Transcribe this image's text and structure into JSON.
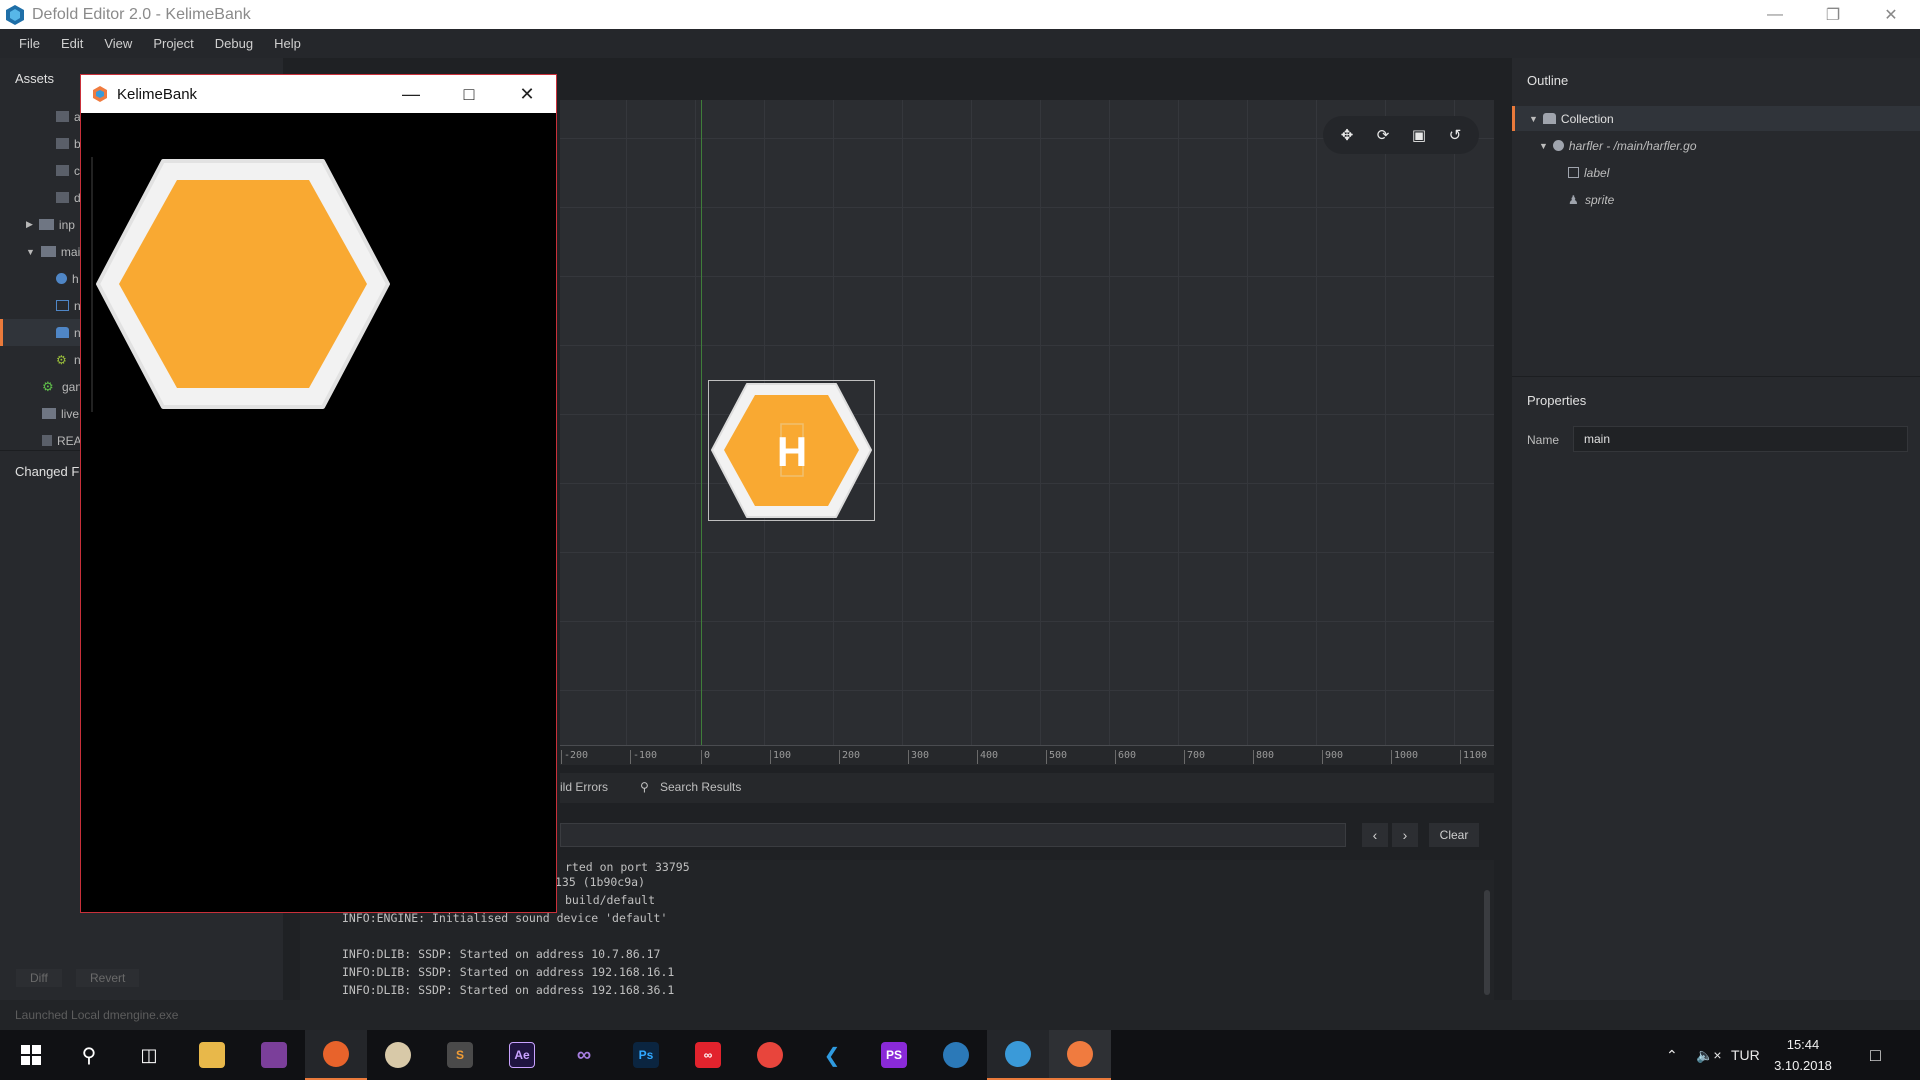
{
  "window": {
    "title": "Defold Editor 2.0 - KelimeBank"
  },
  "menu": [
    "File",
    "Edit",
    "View",
    "Project",
    "Debug",
    "Help"
  ],
  "assets": {
    "title": "Assets",
    "items": [
      {
        "label": "a",
        "icon": "file-icon"
      },
      {
        "label": "b",
        "icon": "file-icon"
      },
      {
        "label": "c",
        "icon": "file-icon"
      },
      {
        "label": "d",
        "icon": "file-icon"
      },
      {
        "label": "inp",
        "icon": "folder-icon"
      },
      {
        "label": "mai",
        "icon": "folder-icon"
      },
      {
        "label": "h",
        "icon": "gameobject-icon"
      },
      {
        "label": "n",
        "icon": "image-icon"
      },
      {
        "label": "n",
        "icon": "collection-icon"
      },
      {
        "label": "n",
        "icon": "gear-icon"
      },
      {
        "label": "gan",
        "icon": "gear-icon"
      },
      {
        "label": "live",
        "icon": "puzzle-icon"
      },
      {
        "label": "REA",
        "icon": "file-icon"
      }
    ]
  },
  "changed_files": {
    "title": "Changed Fil",
    "diff": "Diff",
    "revert": "Revert"
  },
  "status": {
    "text": "Launched Local dmengine.exe"
  },
  "viewport": {
    "ruler": [
      "-200",
      "-100",
      "0",
      "100",
      "200",
      "300",
      "400",
      "500",
      "600",
      "700",
      "800",
      "900",
      "1000",
      "1100"
    ],
    "sprite_letter": "H"
  },
  "console": {
    "tabs": {
      "build_errors": "ild Errors",
      "search_results": "Search Results"
    },
    "clear": "Clear",
    "lines": [
      "rted on port 33795",
      "135 (1b90c9a)",
      "build/default",
      "INFO:ENGINE: Initialised sound device 'default'",
      "",
      "INFO:DLIB: SSDP: Started on address 10.7.86.17",
      "INFO:DLIB: SSDP: Started on address 192.168.16.1",
      "INFO:DLIB: SSDP: Started on address 192.168.36.1"
    ]
  },
  "outline": {
    "title": "Outline",
    "items": [
      {
        "label": "Collection"
      },
      {
        "label": "harfler - /main/harfler.go"
      },
      {
        "label": "label"
      },
      {
        "label": "sprite"
      }
    ]
  },
  "properties": {
    "title": "Properties",
    "name_label": "Name",
    "name_value": "main"
  },
  "game_window": {
    "title": "KelimeBank"
  },
  "taskbar": {
    "language": "TUR",
    "time": "15:44",
    "date": "3.10.2018"
  },
  "colors": {
    "accent": "#ea7a3b",
    "hex_orange": "#f9a932",
    "hex_white": "#f2f2f2"
  }
}
